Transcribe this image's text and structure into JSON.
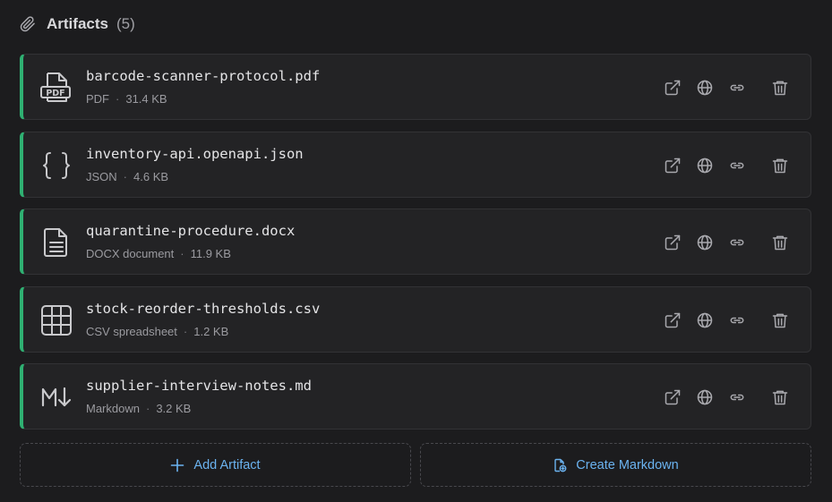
{
  "header": {
    "icon": "paperclip-icon",
    "title": "Artifacts",
    "count": "(5)"
  },
  "accent_color": "#2fb072",
  "link_color": "#6bb3f0",
  "artifacts": [
    {
      "icon": "pdf-file-icon",
      "name": "barcode-scanner-protocol.pdf",
      "type": "PDF",
      "size": "31.4 KB"
    },
    {
      "icon": "json-braces-icon",
      "name": "inventory-api.openapi.json",
      "type": "JSON",
      "size": "4.6 KB"
    },
    {
      "icon": "document-icon",
      "name": "quarantine-procedure.docx",
      "type": "DOCX document",
      "size": "11.9 KB"
    },
    {
      "icon": "spreadsheet-grid-icon",
      "name": "stock-reorder-thresholds.csv",
      "type": "CSV spreadsheet",
      "size": "1.2 KB"
    },
    {
      "icon": "markdown-icon",
      "name": "supplier-interview-notes.md",
      "type": "Markdown",
      "size": "3.2 KB"
    }
  ],
  "row_actions": [
    "open-external-icon",
    "globe-icon",
    "link-icon",
    "trash-icon"
  ],
  "buttons": {
    "add_label": "Add Artifact",
    "create_md_label": "Create Markdown"
  }
}
